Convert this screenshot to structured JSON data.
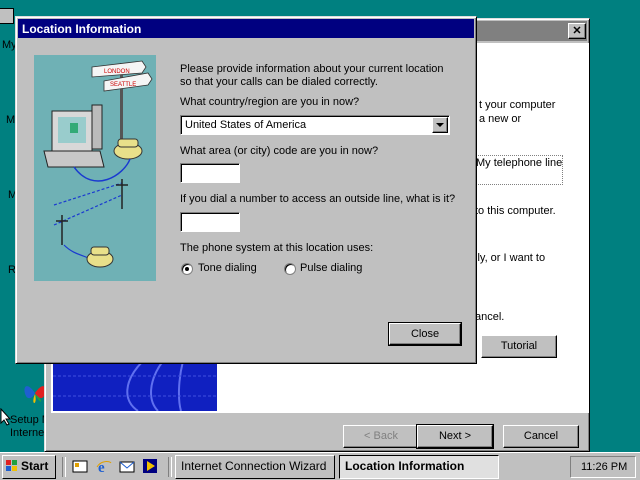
{
  "desktop": {
    "labels": [
      "My",
      "M",
      "M",
      "R",
      "Setup M",
      "Internet"
    ]
  },
  "back_window": {
    "texts": [
      "t your computer",
      "a new or",
      "My telephone line",
      "to this computer.",
      "lly, or I want to",
      "ancel."
    ],
    "tutorial_label": "Tutorial",
    "back_label": "< Back",
    "next_label": "Next >",
    "cancel_label": "Cancel",
    "close_glyph": "✕"
  },
  "dialog": {
    "title": "Location Information",
    "intro": "Please provide information about your current location so that your calls can be dialed correctly.",
    "country_question": "What country/region are you in now?",
    "country_value": "United States of America",
    "area_question": "What area (or city) code are you in now?",
    "area_value": "",
    "outside_question": "If you dial a number to access an outside line, what is it?",
    "outside_value": "",
    "phone_system_label": "The phone system at this location uses:",
    "tone_label": "Tone dialing",
    "pulse_label": "Pulse dialing",
    "close_label": "Close",
    "sign_top": "LONDON",
    "sign_bottom": "SEATTLE"
  },
  "taskbar": {
    "start_label": "Start",
    "task1": "Internet Connection Wizard",
    "task2": "Location Information",
    "clock": "11:26 PM"
  },
  "colors": {
    "desktop": "#008080",
    "title_active": "#000080",
    "face": "#c0c0c0"
  }
}
